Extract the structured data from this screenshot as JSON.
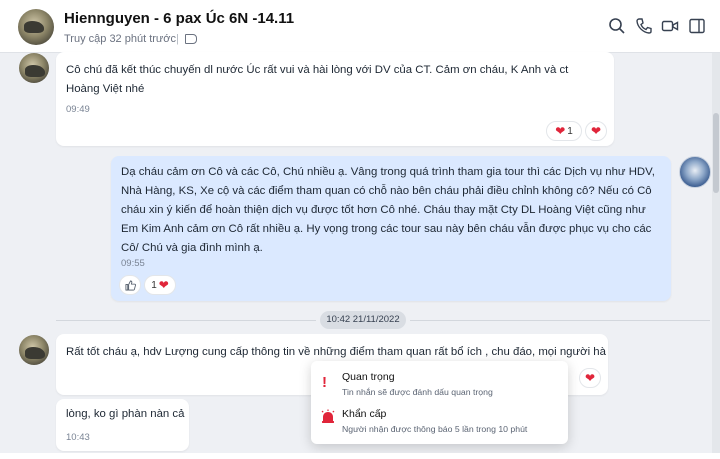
{
  "header": {
    "title": "Hiennguyen - 6 pax Úc 6N -14.11",
    "status": "Truy cập 32 phút trước",
    "separator": "|",
    "icons": [
      "search-icon",
      "phone-icon",
      "video-icon",
      "sidebar-toggle-icon"
    ]
  },
  "messages": [
    {
      "text": "Cô chú đã kết thúc chuyến dl nước Úc rất vui và hài lòng với DV của CT. Cảm ơn cháu, K Anh và ct Hoàng Việt nhé",
      "time": "09:49",
      "reaction_count": "1"
    },
    {
      "text": "Dạ cháu cảm ơn Cô và các Cô, Chú nhiều ạ. Vâng trong quá trình tham gia tour thì các Dịch vụ như HDV, Nhà Hàng, KS, Xe cộ và các điểm tham quan có chỗ nào bên cháu phải điều chỉnh không cô? Nếu có Cô cháu xin ý kiến để hoàn thiện dịch vụ được tốt hơn Cô nhé. Cháu thay mặt Cty DL Hoàng Việt cũng như Em Kim Anh cảm ơn Cô rất nhiều ạ. Hy vọng trong các tour sau này bên cháu vẫn được phục vụ cho các Cô/ Chú và gia đình mình ạ.",
      "time": "09:55",
      "reaction_count": "1"
    },
    {
      "text": "Rất tốt cháu ạ, hdv Lượng cung cấp thông tin về  những điểm tham quan rất bổ ích , chu đáo, mọi người hài"
    },
    {
      "text": "lòng, ko gì phàn nàn cả",
      "time": "10:43"
    }
  ],
  "divider": "10:42 21/11/2022",
  "menu": {
    "items": [
      {
        "title": "Quan trọng",
        "desc": "Tin nhắn sẽ được đánh dấu quan trọng"
      },
      {
        "title": "Khẩn cấp",
        "desc": "Người nhận được thông báo 5 lần trong 10 phút"
      }
    ]
  },
  "colors": {
    "accent": "#dbe9ff",
    "heart": "#e0253a",
    "urgent": "#e0253a"
  }
}
